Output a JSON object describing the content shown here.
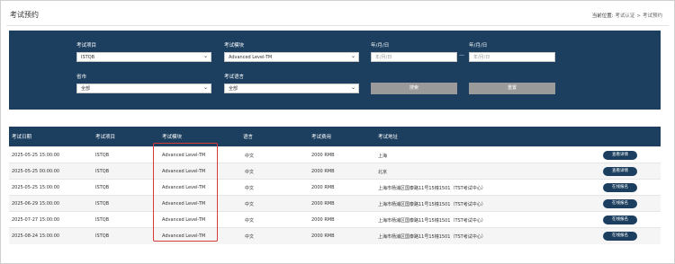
{
  "header": {
    "title": "考试预约",
    "breadcrumb_prefix": "当前位置:",
    "breadcrumb_1": "考试认证",
    "breadcrumb_sep": ">",
    "breadcrumb_2": "考试预约"
  },
  "filters": {
    "project_label": "考试项目",
    "project_value": "ISTQB",
    "module_label": "考试模块",
    "module_value": "Advanced Level-TM",
    "date_label_1": "年/月/日",
    "date_placeholder_1": "年/月/日",
    "date_label_2": "年/月/日",
    "date_placeholder_2": "年/月/日",
    "date_dash": "—",
    "city_label": "省市",
    "city_value": "全部",
    "language_label": "考试语言",
    "language_value": "全部",
    "search_button": "搜索",
    "reset_button": "重置"
  },
  "table": {
    "columns": [
      "考试日期",
      "考试项目",
      "考试模块",
      "语言",
      "考试费用",
      "考试地址"
    ],
    "rows": [
      {
        "date": "2025-05-25 15:00:00",
        "project": "ISTQB",
        "module": "Advanced Level-TM",
        "language": "中文",
        "fee": "2000 RMB",
        "address": "上海",
        "action": "查看详情"
      },
      {
        "date": "2025-05-25 00:00:00",
        "project": "ISTQB",
        "module": "Advanced Level-TM",
        "language": "中文",
        "fee": "2000 RMB",
        "address": "北京",
        "action": "查看详情"
      },
      {
        "date": "2025-05-25 15:00:00",
        "project": "ISTQB",
        "module": "Advanced Level-TM",
        "language": "中文",
        "fee": "2000 RMB",
        "address": "上海市杨浦区国泰路11号15幢1501（TST考试中心）",
        "action": "在线报名"
      },
      {
        "date": "2025-06-29 15:00:00",
        "project": "ISTQB",
        "module": "Advanced Level-TM",
        "language": "中文",
        "fee": "2000 RMB",
        "address": "上海市杨浦区国泰路11号15幢1501（TST考试中心）",
        "action": "在线报名"
      },
      {
        "date": "2025-07-27 15:00:00",
        "project": "ISTQB",
        "module": "Advanced Level-TM",
        "language": "中文",
        "fee": "2000 RMB",
        "address": "上海市杨浦区国泰路11号15幢1501（TST考试中心）",
        "action": "在线报名"
      },
      {
        "date": "2025-08-24 15:00:00",
        "project": "ISTQB",
        "module": "Advanced Level-TM",
        "language": "中文",
        "fee": "2000 RMB",
        "address": "上海市杨浦区国泰路11号15幢1501（TST考试中心）",
        "action": "在线报名"
      }
    ]
  },
  "colors": {
    "primary_navy": "#1c3f5f",
    "highlight_red": "#d93a3a",
    "button_gray": "#9a9a9a"
  }
}
